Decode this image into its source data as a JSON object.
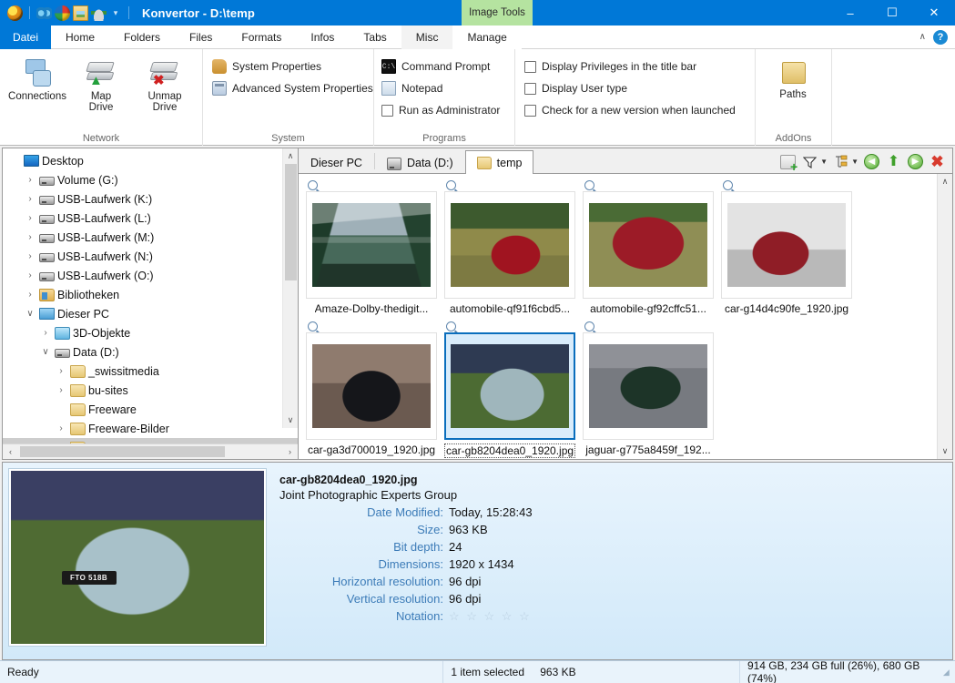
{
  "titlebar": {
    "title": "Konvertor - D:\\temp",
    "quick_access_icons": [
      "konvertor-logo-icon",
      "eyes-icon",
      "color-ball-icon",
      "folder-image-icon",
      "brush-icon"
    ],
    "quick_access_caret": "▾",
    "contextual_tab": "Image Tools",
    "minimize": "–",
    "maximize": "☐",
    "close": "✕"
  },
  "ribbon_tabs": {
    "file_tab": "Datei",
    "tabs": [
      "Home",
      "Folders",
      "Files",
      "Formats",
      "Infos",
      "Tabs",
      "Misc"
    ],
    "contextual_tab": "Manage",
    "collapse_caret": "∧",
    "help": "?"
  },
  "ribbon": {
    "groups": [
      {
        "title": "Network",
        "buttons": [
          {
            "label_line1": "Connections",
            "label_line2": "",
            "icon": "network-connections-icon"
          },
          {
            "label_line1": "Map",
            "label_line2": "Drive",
            "icon": "map-drive-icon"
          },
          {
            "label_line1": "Unmap",
            "label_line2": "Drive",
            "icon": "unmap-drive-icon"
          }
        ]
      },
      {
        "title": "System",
        "items": [
          {
            "label": "System Properties",
            "icon": "system-properties-icon",
            "type": "command"
          },
          {
            "label": "Advanced System Properties",
            "icon": "advanced-system-properties-icon",
            "type": "command"
          }
        ]
      },
      {
        "title": "Programs",
        "items": [
          {
            "label": "Command Prompt",
            "icon": "command-prompt-icon",
            "type": "command"
          },
          {
            "label": "Notepad",
            "icon": "notepad-icon",
            "type": "command"
          },
          {
            "label": "Run as Administrator",
            "icon": "checkbox",
            "type": "checkbox",
            "checked": false
          }
        ]
      },
      {
        "title": "",
        "items": [
          {
            "label": "Display Privileges in the title bar",
            "icon": "checkbox",
            "type": "checkbox",
            "checked": false
          },
          {
            "label": "Display User type",
            "icon": "checkbox",
            "type": "checkbox",
            "checked": false
          },
          {
            "label": "Check for a new version when launched",
            "icon": "checkbox",
            "type": "checkbox",
            "checked": false
          }
        ]
      },
      {
        "title": "AddOns",
        "buttons": [
          {
            "label_line1": "Paths",
            "label_line2": "",
            "icon": "paths-folder-icon"
          }
        ]
      }
    ]
  },
  "tree": {
    "items": [
      {
        "label": "Desktop",
        "indent": 0,
        "chevron": "",
        "icon": "desktop-icon",
        "selected": false
      },
      {
        "label": "Volume (G:)",
        "indent": 1,
        "chevron": "›",
        "icon": "drive-icon",
        "selected": false
      },
      {
        "label": "USB-Laufwerk (K:)",
        "indent": 1,
        "chevron": "›",
        "icon": "drive-icon",
        "selected": false
      },
      {
        "label": "USB-Laufwerk (L:)",
        "indent": 1,
        "chevron": "›",
        "icon": "drive-icon",
        "selected": false
      },
      {
        "label": "USB-Laufwerk (M:)",
        "indent": 1,
        "chevron": "›",
        "icon": "drive-icon",
        "selected": false
      },
      {
        "label": "USB-Laufwerk (N:)",
        "indent": 1,
        "chevron": "›",
        "icon": "drive-icon",
        "selected": false
      },
      {
        "label": "USB-Laufwerk (O:)",
        "indent": 1,
        "chevron": "›",
        "icon": "drive-icon",
        "selected": false
      },
      {
        "label": "Bibliotheken",
        "indent": 1,
        "chevron": "›",
        "icon": "libraries-icon",
        "selected": false
      },
      {
        "label": "Dieser PC",
        "indent": 1,
        "chevron": "∨",
        "icon": "this-pc-icon",
        "selected": false
      },
      {
        "label": "3D-Objekte",
        "indent": 2,
        "chevron": "›",
        "icon": "3d-objects-icon",
        "selected": false
      },
      {
        "label": "Data (D:)",
        "indent": 2,
        "chevron": "∨",
        "icon": "drive-icon",
        "selected": false
      },
      {
        "label": "_swissitmedia",
        "indent": 3,
        "chevron": "›",
        "icon": "folder-icon",
        "selected": false
      },
      {
        "label": "bu-sites",
        "indent": 3,
        "chevron": "›",
        "icon": "folder-icon",
        "selected": false
      },
      {
        "label": "Freeware",
        "indent": 3,
        "chevron": "",
        "icon": "folder-icon",
        "selected": false
      },
      {
        "label": "Freeware-Bilder",
        "indent": 3,
        "chevron": "›",
        "icon": "folder-icon",
        "selected": false
      },
      {
        "label": "temp",
        "indent": 3,
        "chevron": "",
        "icon": "folder-icon",
        "selected": true
      }
    ],
    "scroll_up": "∧",
    "scroll_down": "∨",
    "scroll_left": "‹",
    "scroll_right": "›"
  },
  "browser": {
    "tabs": [
      {
        "label": "Dieser PC",
        "icon": "this-pc-icon",
        "active": false
      },
      {
        "label": "Data (D:)",
        "icon": "drive-icon",
        "active": false
      },
      {
        "label": "temp",
        "icon": "folder-icon",
        "active": true
      }
    ],
    "toolbar": [
      {
        "name": "add-tab-icon",
        "caret": false
      },
      {
        "name": "filter-icon",
        "caret": true
      },
      {
        "name": "sort-icon",
        "caret": true
      },
      {
        "name": "back-icon",
        "caret": false
      },
      {
        "name": "up-icon",
        "caret": false
      },
      {
        "name": "forward-icon",
        "caret": false
      },
      {
        "name": "close-tab-icon",
        "caret": false
      }
    ],
    "scroll_up": "∧",
    "scroll_down": "∨",
    "thumbnails": [
      {
        "label": "Amaze-Dolby-thedigit...",
        "art": "img-mountain",
        "selected": false
      },
      {
        "label": "automobile-qf91f6cbd5...",
        "art": "img-redcar1",
        "selected": false
      },
      {
        "label": "automobile-gf92cffc51...",
        "art": "img-redcar2",
        "selected": false
      },
      {
        "label": "car-g14d4c90fe_1920.jpg",
        "art": "img-redcar3",
        "selected": false
      },
      {
        "label": "car-ga3d700019_1920.jpg",
        "art": "img-blackcar",
        "selected": false
      },
      {
        "label": "car-gb8204dea0_1920.jpg",
        "art": "img-silvercar",
        "selected": true
      },
      {
        "label": "jaguar-g775a8459f_192...",
        "art": "img-greencar",
        "selected": false
      }
    ]
  },
  "preview": {
    "plate_text": "FTO 518B",
    "filename": "car-gb8204dea0_1920.jpg",
    "filetype": "Joint Photographic Experts Group",
    "properties": [
      {
        "key": "Date Modified:",
        "value": "Today, 15:28:43"
      },
      {
        "key": "Size:",
        "value": "963 KB"
      },
      {
        "key": "Bit depth:",
        "value": "24"
      },
      {
        "key": "Dimensions:",
        "value": "1920 x 1434"
      },
      {
        "key": "Horizontal resolution:",
        "value": "96 dpi"
      },
      {
        "key": "Vertical resolution:",
        "value": "96 dpi"
      }
    ],
    "rating_key": "Notation:",
    "rating_stars": "☆ ☆ ☆ ☆ ☆"
  },
  "statusbar": {
    "status": "Ready",
    "selection": "1 item selected",
    "selection_size": "963 KB",
    "disk_info": "914 GB,  234 GB full (26%),  680 GB  (74%)"
  },
  "colors": {
    "accent": "#0078d7",
    "contextual": "#b5e3a0",
    "selection": "#0a6ebd",
    "key_label": "#3d7cb8"
  }
}
